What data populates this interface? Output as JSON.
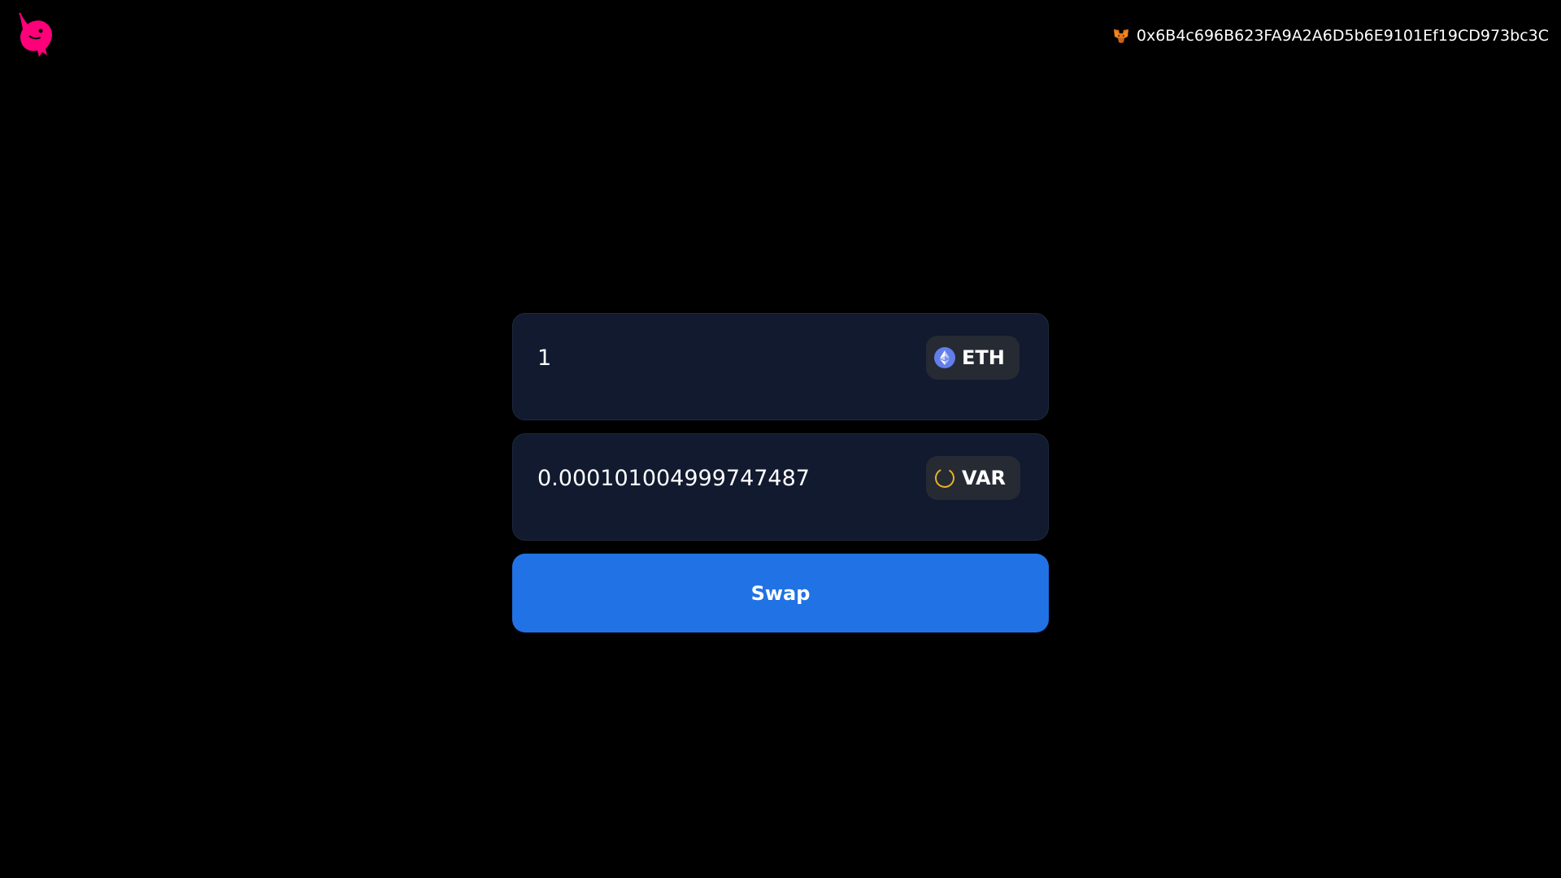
{
  "header": {
    "logo_icon": "uniswap-unicorn-icon",
    "wallet": {
      "icon": "metamask-fox-icon",
      "address": "0x6B4c696B623FA9A2A6D5b6E9101Ef19CD973bc3C"
    }
  },
  "swap": {
    "from": {
      "amount": "1",
      "token_symbol": "ETH",
      "token_icon": "ethereum-icon"
    },
    "to": {
      "amount": "0.000101004999747487",
      "token_symbol": "VAR",
      "token_icon": "var-token-icon"
    },
    "button_label": "Swap"
  },
  "colors": {
    "background": "#000000",
    "card": "#111a2e",
    "token_pill": "#262a33",
    "accent": "#2172e5",
    "logo": "#ff007a"
  }
}
